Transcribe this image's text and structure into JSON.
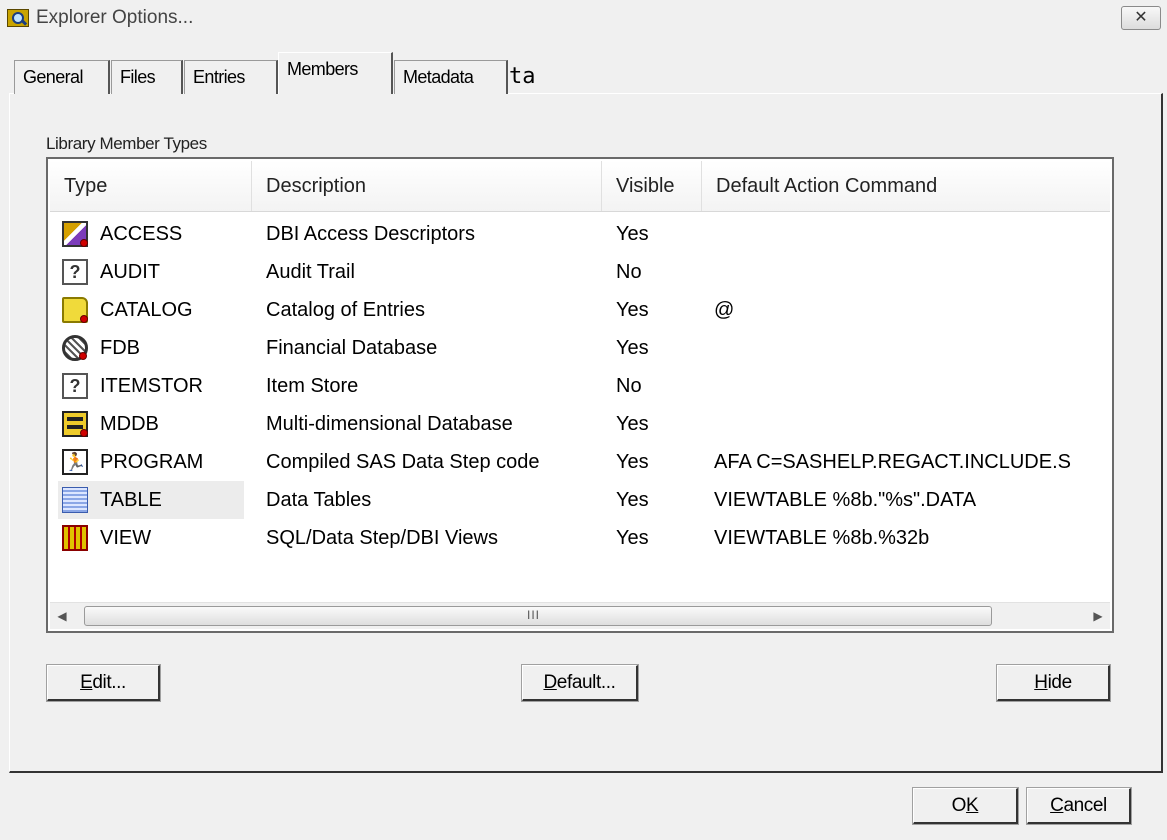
{
  "window": {
    "title": "Explorer Options...",
    "close_glyph": "✕"
  },
  "tabs": [
    {
      "label": "General",
      "active": false
    },
    {
      "label": "Files",
      "active": false
    },
    {
      "label": "Entries",
      "active": false
    },
    {
      "label": "Members",
      "active": true
    },
    {
      "label": "Metadata",
      "active": false
    }
  ],
  "tab_overflow": "ta",
  "group": {
    "label": "Library Member Types"
  },
  "listview": {
    "columns": [
      "Type",
      "Description",
      "Visible",
      "Default Action Command"
    ],
    "rows": [
      {
        "type": "ACCESS",
        "description": "DBI Access Descriptors",
        "visible": "Yes",
        "command": "",
        "icon": "access-icon",
        "glyph": ""
      },
      {
        "type": "AUDIT",
        "description": "Audit Trail",
        "visible": "No",
        "command": "",
        "icon": "audit-icon",
        "glyph": "?"
      },
      {
        "type": "CATALOG",
        "description": "Catalog of Entries",
        "visible": "Yes",
        "command": "@",
        "icon": "catalog-icon",
        "glyph": ""
      },
      {
        "type": "FDB",
        "description": "Financial Database",
        "visible": "Yes",
        "command": "",
        "icon": "fdb-icon",
        "glyph": ""
      },
      {
        "type": "ITEMSTOR",
        "description": "Item Store",
        "visible": "No",
        "command": "",
        "icon": "itemstor-icon",
        "glyph": "?"
      },
      {
        "type": "MDDB",
        "description": "Multi-dimensional Database",
        "visible": "Yes",
        "command": "",
        "icon": "mddb-icon",
        "glyph": ""
      },
      {
        "type": "PROGRAM",
        "description": "Compiled SAS Data Step code",
        "visible": "Yes",
        "command": "AFA C=SASHELP.REGACT.INCLUDE.S",
        "icon": "program-icon",
        "glyph": "🏃"
      },
      {
        "type": "TABLE",
        "description": "Data Tables",
        "visible": "Yes",
        "command": "VIEWTABLE %8b.\"%s\".DATA",
        "icon": "table-icon",
        "glyph": "",
        "selected": true
      },
      {
        "type": "VIEW",
        "description": "SQL/Data Step/DBI Views",
        "visible": "Yes",
        "command": "VIEWTABLE %8b.%32b",
        "icon": "view-icon",
        "glyph": ""
      }
    ],
    "scrollbar": {
      "left_arrow": "◀",
      "right_arrow": "▶",
      "grip": "III"
    }
  },
  "buttons": {
    "edit": {
      "mnemonic": "E",
      "rest": "dit..."
    },
    "default": {
      "mnemonic": "D",
      "rest": "efault..."
    },
    "hide": {
      "mnemonic": "H",
      "rest": "ide"
    },
    "ok": {
      "pre": "O",
      "mnemonic": "K",
      "rest": ""
    },
    "cancel": {
      "mnemonic": "C",
      "rest": "ancel"
    }
  }
}
